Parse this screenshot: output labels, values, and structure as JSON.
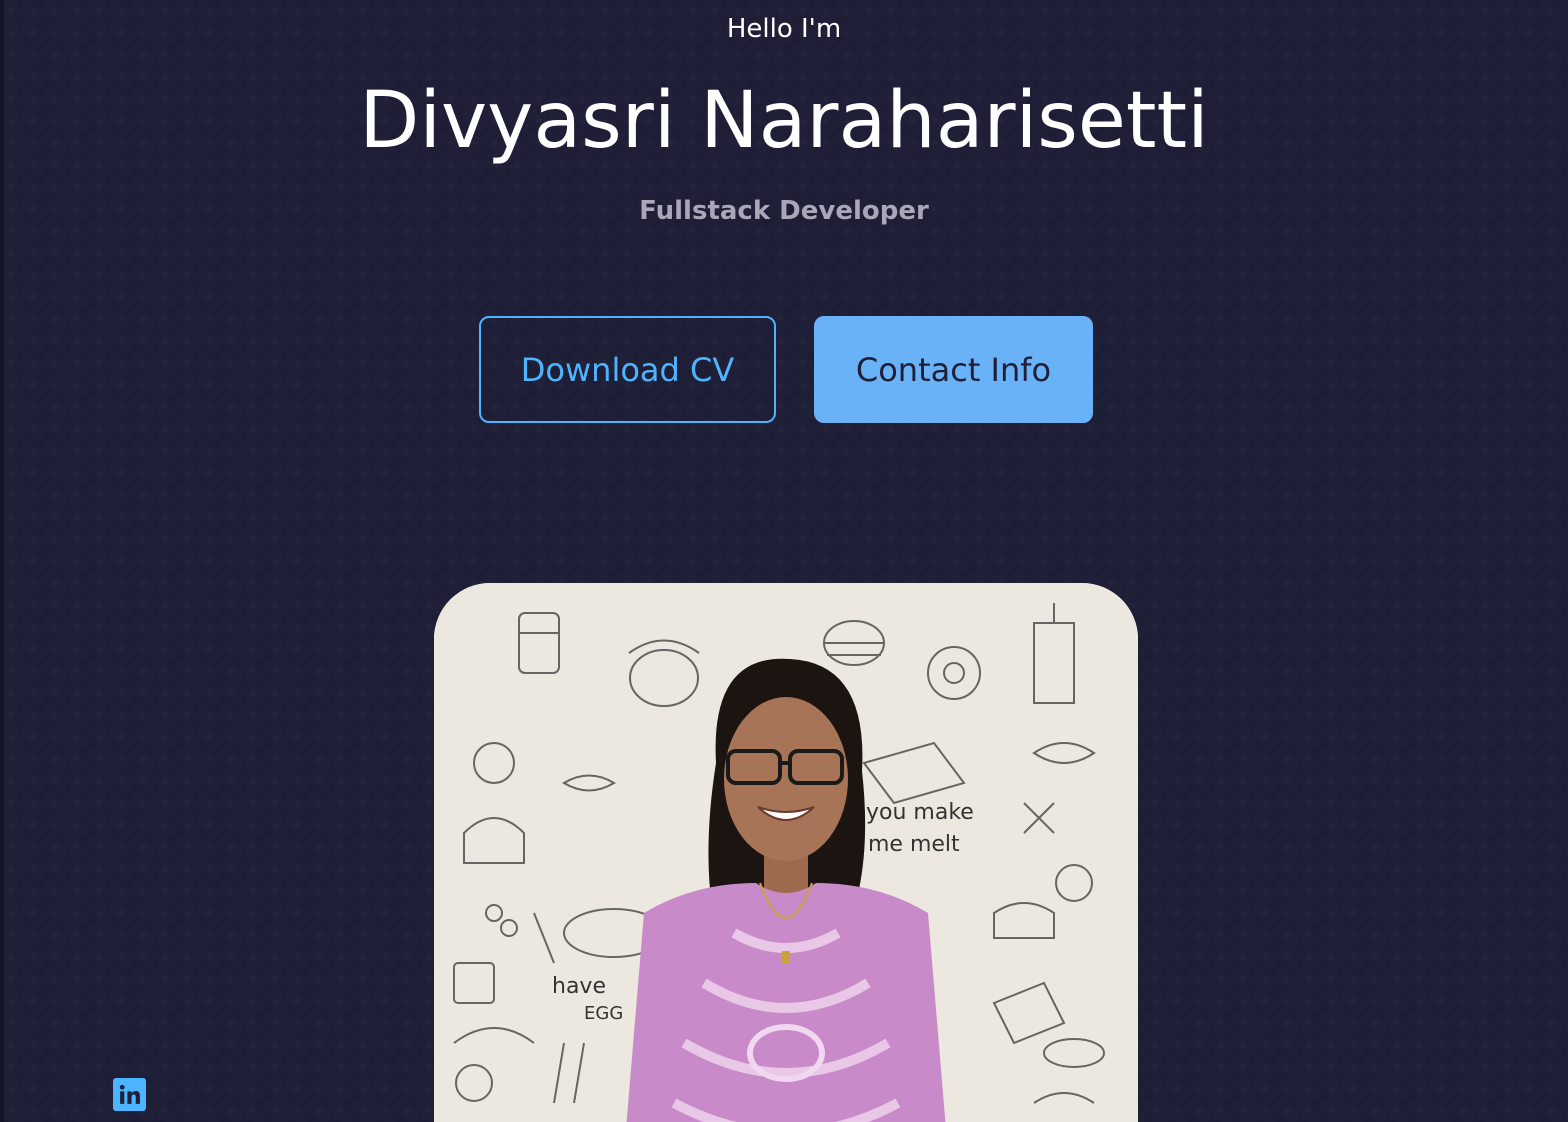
{
  "header": {
    "greeting": "Hello I'm",
    "name": "Divyasri Naraharisetti",
    "role": "Fullstack Developer"
  },
  "cta": {
    "download_label": "Download CV",
    "contact_label": "Contact Info"
  },
  "photo": {
    "wall_text_1": "you make",
    "wall_text_2": "me melt",
    "wall_text_3": "have",
    "wall_text_4": "EGG"
  },
  "social": {
    "linkedin_icon": "linkedin-icon"
  },
  "colors": {
    "background": "#1f1f38",
    "primary": "#4db5ff",
    "primary_solid": "#69b2f8",
    "muted_text": "#a8a8b8"
  }
}
